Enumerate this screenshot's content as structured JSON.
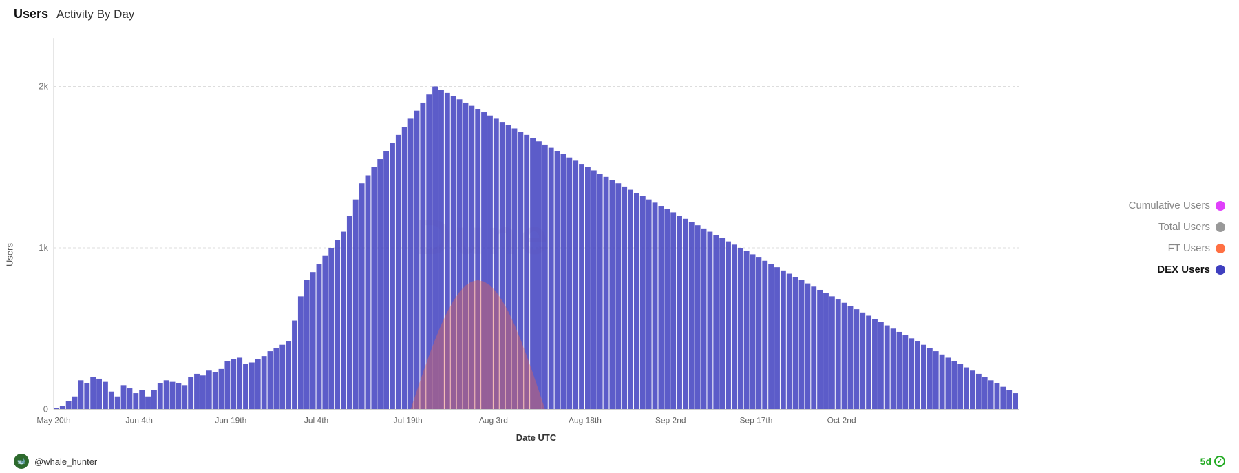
{
  "header": {
    "users_label": "Users",
    "title": "Activity By Day"
  },
  "yAxis": {
    "label": "Users",
    "ticks": [
      "2k",
      "1k",
      "0"
    ]
  },
  "xAxis": {
    "label": "Date UTC",
    "ticks": [
      "May 20th",
      "Jun 4th",
      "Jun 19th",
      "Jul 4th",
      "Jul 19th",
      "Aug 3rd",
      "Aug 18th",
      "Sep 2nd",
      "Sep 17th",
      "Oct 2nd"
    ]
  },
  "legend": [
    {
      "label": "Cumulative Users",
      "color": "#e040fb",
      "bold": false
    },
    {
      "label": "Total Users",
      "color": "#999",
      "bold": false
    },
    {
      "label": "FT Users",
      "color": "#ff7043",
      "bold": false
    },
    {
      "label": "DEX Users",
      "color": "#3f3fbf",
      "bold": true
    }
  ],
  "footer": {
    "username": "@whale_hunter",
    "timeframe": "5d"
  },
  "watermark": "Dune",
  "chart": {
    "maxValue": 2300,
    "bars": [
      10,
      20,
      50,
      80,
      180,
      160,
      200,
      190,
      170,
      110,
      80,
      150,
      130,
      100,
      120,
      80,
      120,
      160,
      180,
      170,
      160,
      150,
      200,
      220,
      210,
      240,
      230,
      250,
      300,
      310,
      320,
      280,
      290,
      310,
      330,
      360,
      380,
      400,
      420,
      550,
      700,
      800,
      850,
      900,
      950,
      1000,
      1050,
      1100,
      1200,
      1300,
      1400,
      1450,
      1500,
      1550,
      1600,
      1650,
      1700,
      1750,
      1800,
      1850,
      1900,
      1950,
      2000,
      1980,
      1960,
      1940,
      1920,
      1900,
      1880,
      1860,
      1840,
      1820,
      1800,
      1780,
      1760,
      1740,
      1720,
      1700,
      1680,
      1660,
      1640,
      1620,
      1600,
      1580,
      1560,
      1540,
      1520,
      1500,
      1480,
      1460,
      1440,
      1420,
      1400,
      1380,
      1360,
      1340,
      1320,
      1300,
      1280,
      1260,
      1240,
      1220,
      1200,
      1180,
      1160,
      1140,
      1120,
      1100,
      1080,
      1060,
      1040,
      1020,
      1000,
      980,
      960,
      940,
      920,
      900,
      880,
      860,
      840,
      820,
      800,
      780,
      760,
      740,
      720,
      700,
      680,
      660,
      640,
      620,
      600,
      580,
      560,
      540,
      520,
      500,
      480,
      460,
      440,
      420,
      400,
      380,
      360,
      340,
      320,
      300,
      280,
      260,
      240,
      220,
      200,
      180,
      160,
      140,
      120,
      100
    ]
  }
}
